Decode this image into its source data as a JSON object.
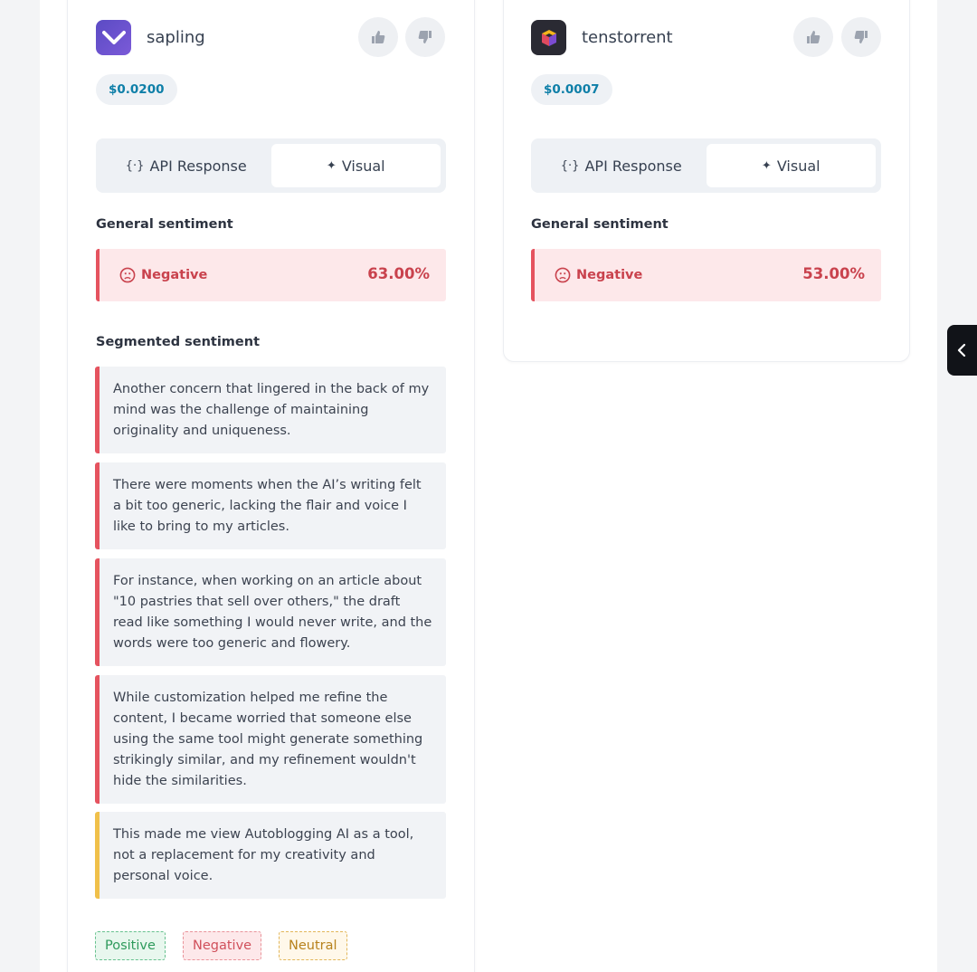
{
  "providers": [
    {
      "name": "sapling",
      "price": "$0.0200",
      "tabs": {
        "api": "API Response",
        "visual": "Visual"
      },
      "general_title": "General sentiment",
      "general": {
        "label": "Negative",
        "percent": "63.00%"
      },
      "segmented_title": "Segmented sentiment",
      "segments": [
        {
          "text": "Another concern that lingered in the back of my mind was the challenge of maintaining originality and uniqueness.",
          "sentiment": "negative"
        },
        {
          "text": "There were moments when the AI’s writing felt a bit too generic, lacking the flair and voice I like to bring to my articles.",
          "sentiment": "negative"
        },
        {
          "text": "For instance, when working on an article about \"10 pastries that sell over others,\" the draft read like something I would never write, and the words were too generic and flowery.",
          "sentiment": "negative"
        },
        {
          "text": "While customization helped me refine the content, I became worried that someone else using the same tool might generate something strikingly similar, and my refinement wouldn't hide the similarities.",
          "sentiment": "negative"
        },
        {
          "text": "This made me view Autoblogging AI as a tool, not a replacement for my creativity and personal voice.",
          "sentiment": "neutral"
        }
      ]
    },
    {
      "name": "tenstorrent",
      "price": "$0.0007",
      "tabs": {
        "api": "API Response",
        "visual": "Visual"
      },
      "general_title": "General sentiment",
      "general": {
        "label": "Negative",
        "percent": "53.00%"
      }
    }
  ],
  "legend": {
    "positive": "Positive",
    "negative": "Negative",
    "neutral": "Neutral"
  },
  "colors": {
    "negative": "#e5535f",
    "neutral": "#f0c04a",
    "positive": "#2e9a5c",
    "price": "#0e7fa8"
  }
}
